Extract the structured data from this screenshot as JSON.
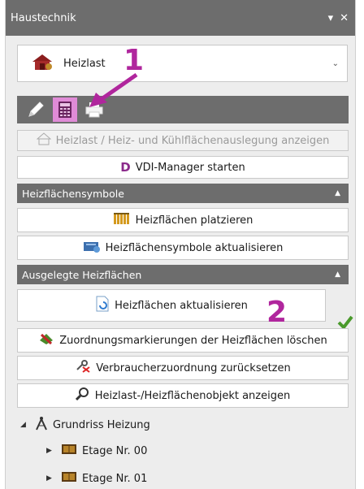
{
  "window": {
    "title": "Haustechnik",
    "pin_glyph": "▾",
    "close_glyph": "✕"
  },
  "dropdown": {
    "selected": "Heizlast",
    "chevron": "⌄"
  },
  "toolbar": {
    "tools": [
      "pencil-tool",
      "calculator-tool",
      "printer-tool"
    ],
    "active_index": 1
  },
  "buttons": {
    "show_heatload": "Heizlast / Heiz- und Kühlflächenauslegung anzeigen",
    "vdi_manager": "VDI-Manager starten",
    "place_heating": "Heizflächen platzieren",
    "update_symbols": "Heizflächensymbole aktualisieren",
    "update_heating": "Heizflächen aktualisieren",
    "delete_markers": "Zuordnungsmarkierungen der Heizflächen löschen",
    "reset_consumer": "Verbraucherzuordnung zurücksetzen",
    "show_object": "Heizlast-/Heizflächenobjekt anzeigen"
  },
  "sections": {
    "symbols": "Heizflächensymbole",
    "designed": "Ausgelegte Heizflächen",
    "caret": "▲"
  },
  "tree": {
    "root": "Grundriss Heizung",
    "root_toggle": "◢",
    "items": [
      {
        "label": "Etage Nr. 00",
        "toggle": "▶"
      },
      {
        "label": "Etage Nr. 01",
        "toggle": "▶"
      }
    ]
  },
  "annotations": {
    "one": "1",
    "two": "2"
  },
  "colors": {
    "header": "#6d6d6d",
    "highlight": "#e08bd7",
    "annotation": "#b0269d",
    "check": "#4a9a2c"
  }
}
